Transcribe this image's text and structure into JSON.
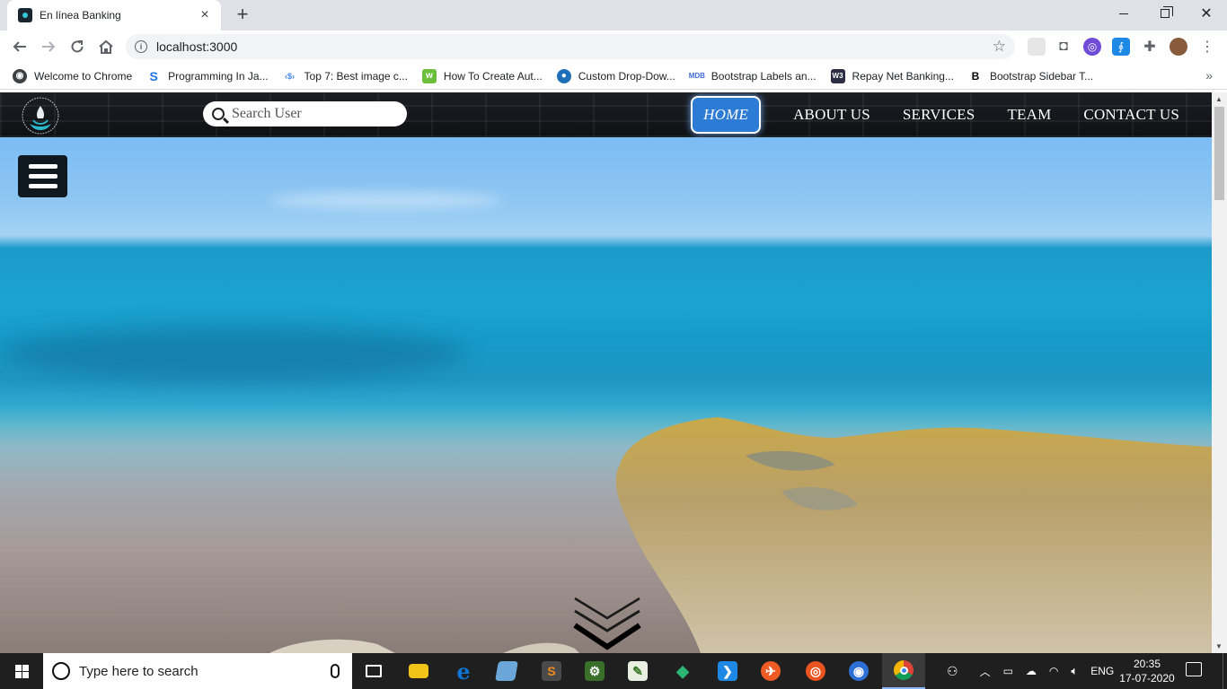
{
  "browser": {
    "tab": {
      "title": "En línea Banking",
      "close": "×"
    },
    "new_tab": "+",
    "window_controls": {
      "close": "✕"
    },
    "omnibox": {
      "url": "localhost:3000"
    },
    "bookmarks": [
      {
        "label": "Welcome to Chrome",
        "icon": "chrome-globe-icon",
        "color": "#3c4043",
        "glyph": "◉"
      },
      {
        "label": "Programming In Ja...",
        "icon": "s-logo-icon",
        "color": "#1a73e8",
        "glyph": "S"
      },
      {
        "label": "Top 7: Best image c...",
        "icon": "arrows-icon",
        "color": "#4285f4",
        "glyph": "‹$›"
      },
      {
        "label": "How To Create Aut...",
        "icon": "w3-green-icon",
        "color": "#6bbf3a",
        "glyph": "w"
      },
      {
        "label": "Custom Drop-Dow...",
        "icon": "drop-icon",
        "color": "#1e6fb8",
        "glyph": "◆"
      },
      {
        "label": "Bootstrap Labels an...",
        "icon": "mdb-icon",
        "color": "#3f6ad8",
        "glyph": "M"
      },
      {
        "label": "Repay Net Banking...",
        "icon": "w3schools-icon",
        "color": "#2c2c44",
        "glyph": "W"
      },
      {
        "label": "Bootstrap Sidebar T...",
        "icon": "b-logo-icon",
        "color": "#ffffff",
        "glyph": "B"
      }
    ],
    "bookmarks_more": "»"
  },
  "page": {
    "search_placeholder": "Search User",
    "nav": [
      {
        "label": "HOME",
        "active": true
      },
      {
        "label": "ABOUT US"
      },
      {
        "label": "SERVICES"
      },
      {
        "label": "TEAM"
      },
      {
        "label": "CONTACT US"
      }
    ],
    "colors": {
      "active_nav": "#2c7bd4",
      "navbar": "#15181c",
      "sea": "#1ba4d1",
      "sky": "#8ec6f2"
    }
  },
  "taskbar": {
    "search_text": "Type here to search",
    "apps": [
      {
        "name": "task-view-icon",
        "color": "#1f1f1f",
        "glyph": "❐"
      },
      {
        "name": "file-explorer-icon",
        "color": "#f2c318",
        "glyph": "▬"
      },
      {
        "name": "edge-icon",
        "color": "#0f73d2",
        "glyph": "e"
      },
      {
        "name": "notepad-icon",
        "color": "#6aa7d8",
        "glyph": "◫"
      },
      {
        "name": "sublime-icon",
        "color": "#f08a1c",
        "glyph": "S"
      },
      {
        "name": "app-icon",
        "color": "#3a6f2a",
        "glyph": "⚙"
      },
      {
        "name": "notepadpp-icon",
        "color": "#7bb661",
        "glyph": "✎"
      },
      {
        "name": "gitkraken-icon",
        "color": "#2b8a5e",
        "glyph": "◆"
      },
      {
        "name": "vscode-icon",
        "color": "#1e88e5",
        "glyph": "❯"
      },
      {
        "name": "postman-icon",
        "color": "#ef5b25",
        "glyph": "✈"
      },
      {
        "name": "ubuntu-icon",
        "color": "#e95420",
        "glyph": "◎"
      },
      {
        "name": "firefox-icon",
        "color": "#2e6fd6",
        "glyph": "◉"
      },
      {
        "name": "chrome-icon",
        "color": "#db4437",
        "glyph": "◉"
      }
    ],
    "language": "ENG",
    "time": "20:35",
    "date": "17-07-2020"
  }
}
